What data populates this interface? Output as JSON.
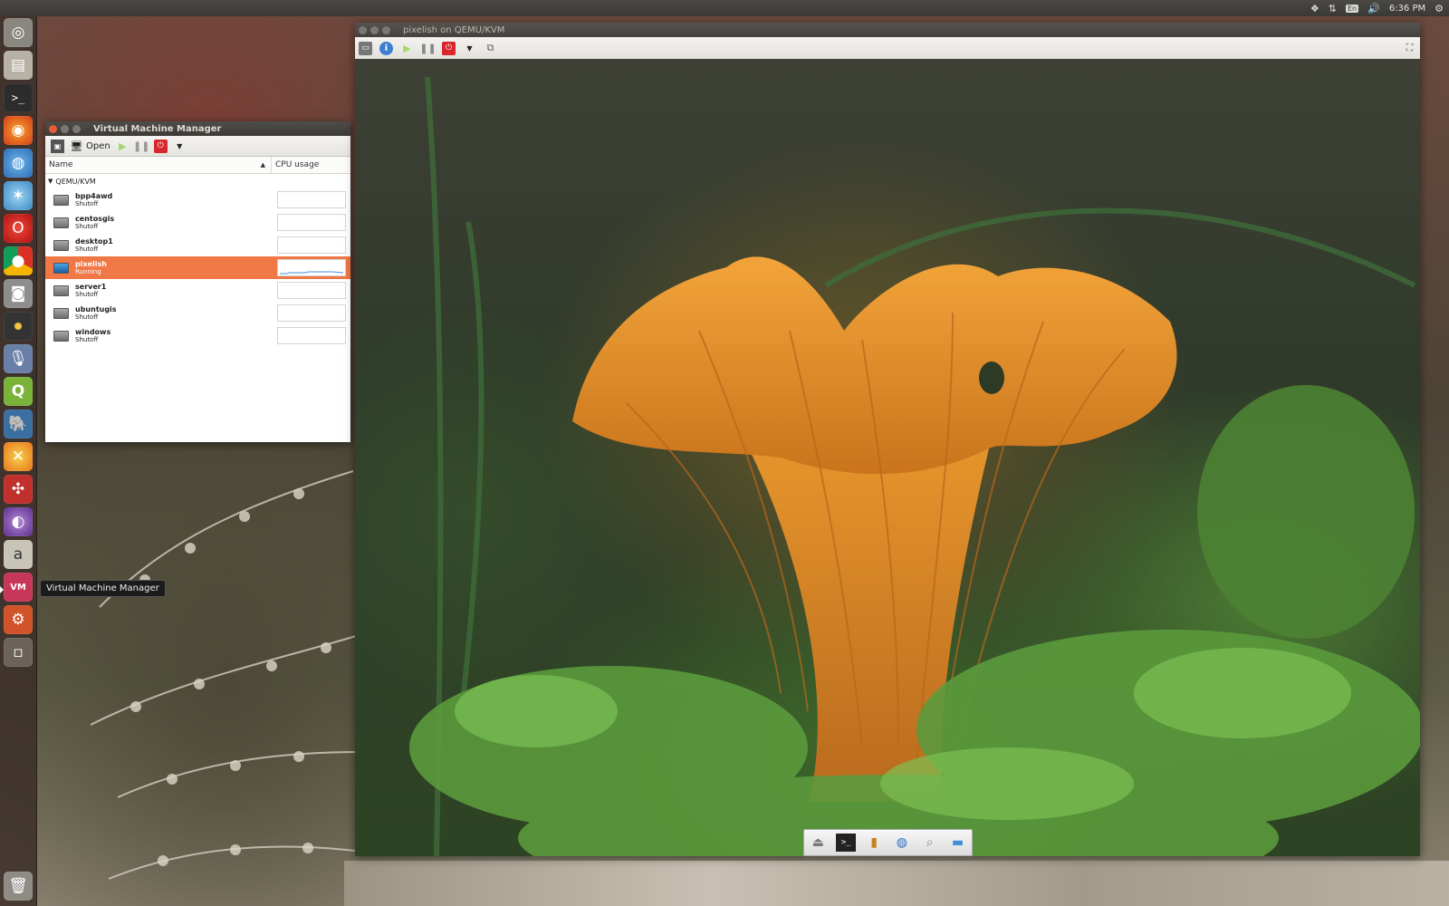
{
  "top_panel": {
    "lang": "En",
    "clock": "6:36 PM"
  },
  "launcher": {
    "tooltip": "Virtual Machine Manager"
  },
  "vmm_window": {
    "title": "Virtual Machine Manager",
    "toolbar": {
      "open_label": "Open"
    },
    "columns": {
      "name": "Name",
      "cpu": "CPU usage"
    },
    "group": "QEMU/KVM",
    "vms": [
      {
        "name": "bpp4awd",
        "status": "Shutoff"
      },
      {
        "name": "centosgis",
        "status": "Shutoff"
      },
      {
        "name": "desktop1",
        "status": "Shutoff"
      },
      {
        "name": "pixelish",
        "status": "Running"
      },
      {
        "name": "server1",
        "status": "Shutoff"
      },
      {
        "name": "ubuntugis",
        "status": "Shutoff"
      },
      {
        "name": "windows",
        "status": "Shutoff"
      }
    ]
  },
  "viewer_window": {
    "title": "pixelish on QEMU/KVM"
  },
  "colors": {
    "selection": "#f07746",
    "titlebar": "#3c3b37",
    "launcher": "#3c302a"
  }
}
